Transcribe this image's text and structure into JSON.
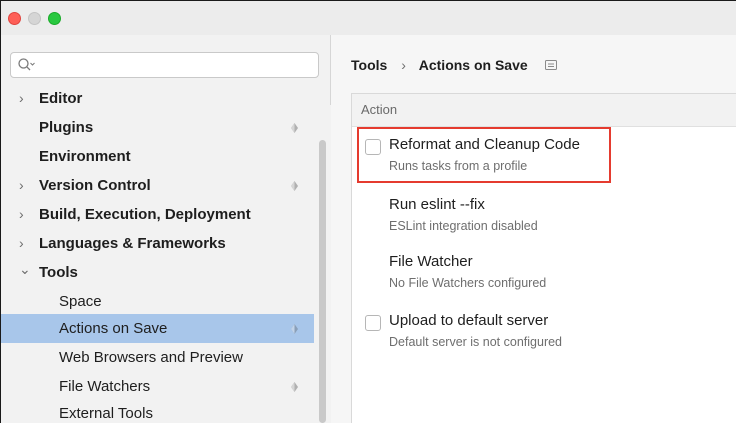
{
  "window": {
    "controls": [
      "close",
      "minimize",
      "zoom"
    ]
  },
  "sidebar": {
    "search": {
      "placeholder": "",
      "value": ""
    },
    "items": [
      {
        "label": "Editor",
        "expandable": true,
        "expanded": false,
        "bold": true,
        "shared": false
      },
      {
        "label": "Plugins",
        "expandable": false,
        "bold": true,
        "shared": true
      },
      {
        "label": "Environment",
        "expandable": false,
        "bold": true,
        "shared": false
      },
      {
        "label": "Version Control",
        "expandable": true,
        "expanded": false,
        "bold": true,
        "shared": true
      },
      {
        "label": "Build, Execution, Deployment",
        "expandable": true,
        "expanded": false,
        "bold": true,
        "shared": false
      },
      {
        "label": "Languages & Frameworks",
        "expandable": true,
        "expanded": false,
        "bold": true,
        "shared": false
      },
      {
        "label": "Tools",
        "expandable": true,
        "expanded": true,
        "bold": true,
        "shared": false
      },
      {
        "label": "Space",
        "child": true,
        "shared": false
      },
      {
        "label": "Actions on Save",
        "child": true,
        "selected": true,
        "shared": true
      },
      {
        "label": "Web Browsers and Preview",
        "child": true,
        "shared": false
      },
      {
        "label": "File Watchers",
        "child": true,
        "shared": true
      },
      {
        "label": "External Tools",
        "child": true,
        "shared": false
      }
    ],
    "arrow_collapsed": "›",
    "arrow_expanded": "⌄"
  },
  "main": {
    "breadcrumb": {
      "parent": "Tools",
      "separator": "›",
      "current": "Actions on Save"
    },
    "table_header": "Action",
    "actions": [
      {
        "title": "Reformat and Cleanup Code",
        "subtitle": "Runs tasks from a profile",
        "has_checkbox": true,
        "checked": false,
        "highlighted": true
      },
      {
        "title": "Run eslint --fix",
        "subtitle": "ESLint integration disabled",
        "has_checkbox": false
      },
      {
        "title": "File Watcher",
        "subtitle": "No File Watchers configured",
        "has_checkbox": false
      },
      {
        "title": "Upload to default server",
        "subtitle": "Default server is not configured",
        "has_checkbox": true,
        "checked": false
      }
    ]
  },
  "colors": {
    "selection": "#a8c6ea",
    "highlight_border": "#e53b2f",
    "close": "#fe5f57",
    "zoom": "#29c840"
  }
}
